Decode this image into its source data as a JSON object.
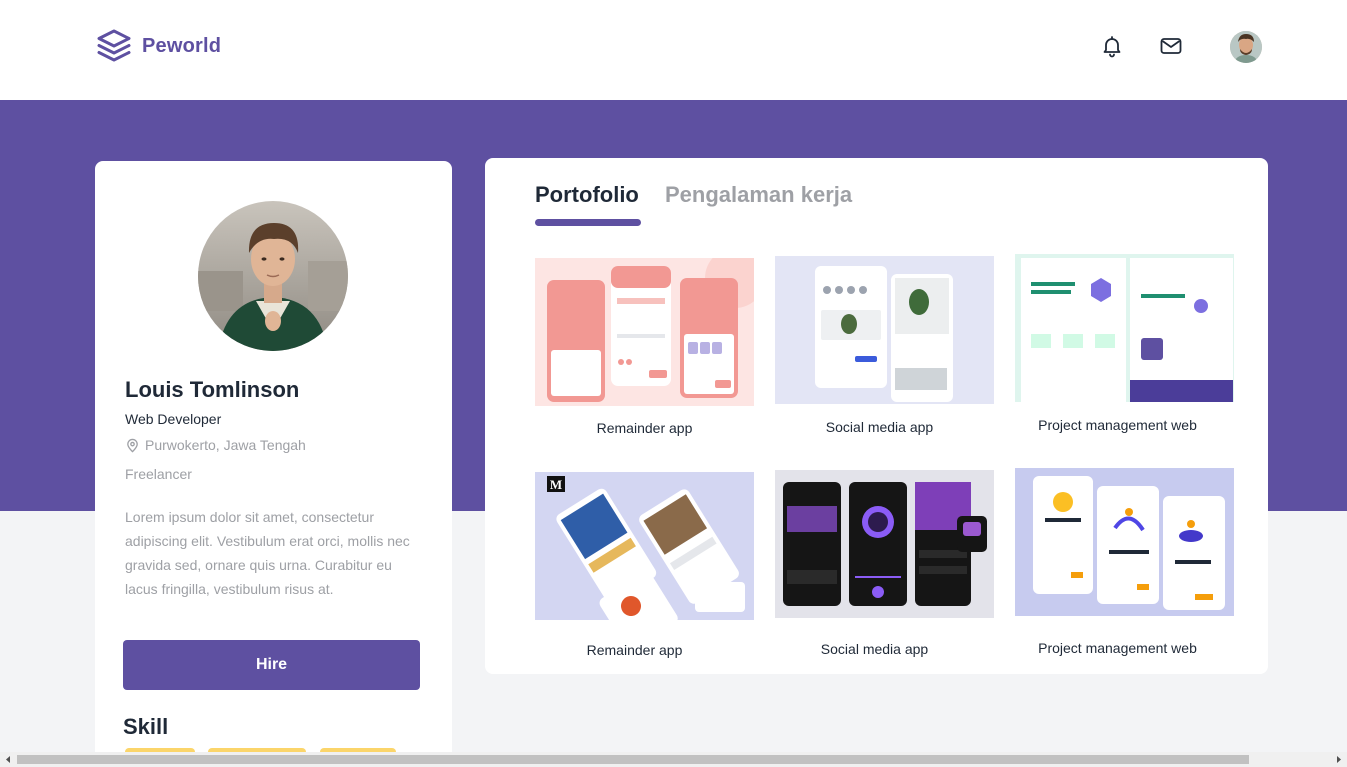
{
  "navbar": {
    "brand_name": "Peworld",
    "icons": [
      "layers-logo-icon",
      "bell-icon",
      "mail-icon",
      "user-avatar"
    ]
  },
  "colors": {
    "primary": "#5e50a1",
    "muted_text": "#9ea0a5",
    "skill_chip": "#fbd56a",
    "page_bg": "#f3f4f6"
  },
  "profile": {
    "name": "Louis Tomlinson",
    "role": "Web Developer",
    "location": "Purwokerto, Jawa Tengah",
    "status": "Freelancer",
    "bio": "Lorem ipsum dolor sit amet, consectetur adipiscing elit. Vestibulum erat orci, mollis nec gravida sed, ornare quis urna. Curabitur eu lacus fringilla, vestibulum risus at.",
    "hire_label": "Hire",
    "skill_title": "Skill"
  },
  "tabs": [
    {
      "label": "Portofolio",
      "active": true
    },
    {
      "label": "Pengalaman kerja",
      "active": false
    }
  ],
  "portfolio": [
    {
      "title": "Remainder app"
    },
    {
      "title": "Social media app"
    },
    {
      "title": "Project management web"
    },
    {
      "title": "Remainder app"
    },
    {
      "title": "Social media app"
    },
    {
      "title": "Project management web"
    }
  ]
}
